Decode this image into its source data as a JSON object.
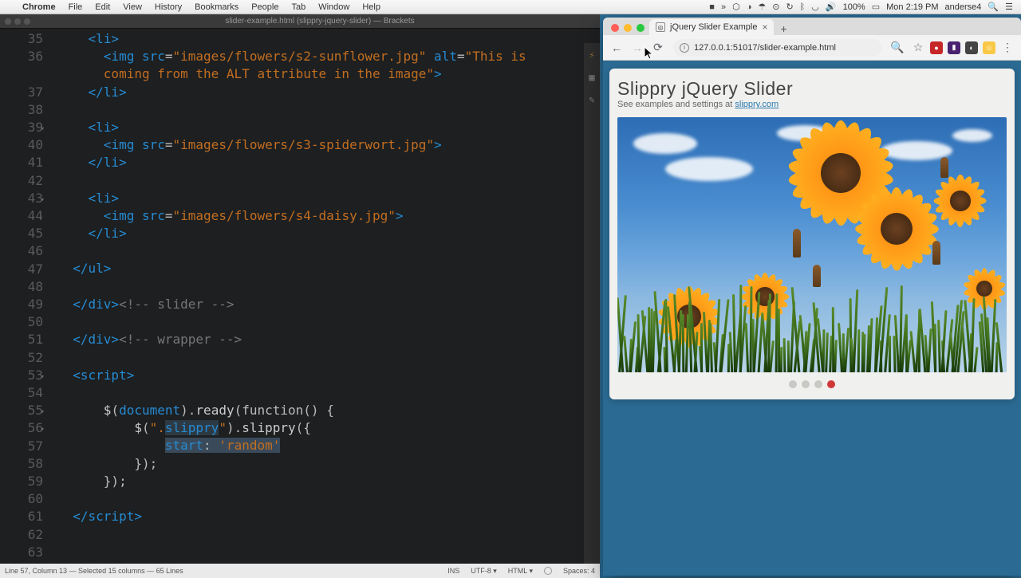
{
  "menubar": {
    "app": "Chrome",
    "items": [
      "File",
      "Edit",
      "View",
      "History",
      "Bookmarks",
      "People",
      "Tab",
      "Window",
      "Help"
    ],
    "time": "Mon 2:19 PM",
    "user": "anderse4",
    "battery": "100%"
  },
  "brackets": {
    "title": "slider-example.html (slippry-jquery-slider) — Brackets",
    "code": {
      "lines": [
        {
          "n": 35,
          "fold": false,
          "segs": [
            [
              "    ",
              "plain"
            ],
            [
              "<li>",
              "tag"
            ]
          ]
        },
        {
          "n": 36,
          "fold": false,
          "segs": [
            [
              "      ",
              "plain"
            ],
            [
              "<img ",
              "tag"
            ],
            [
              "src",
              "attr"
            ],
            [
              "=",
              "punct"
            ],
            [
              "\"images/flowers/s2-sunflower.jpg\"",
              "str"
            ],
            [
              " ",
              "plain"
            ],
            [
              "alt",
              "attr"
            ],
            [
              "=",
              "punct"
            ],
            [
              "\"This is",
              "str"
            ]
          ]
        },
        {
          "n": 0,
          "cont": true,
          "segs": [
            [
              "      ",
              "plain"
            ],
            [
              "coming from the ALT attribute in the image\"",
              "str"
            ],
            [
              ">",
              "tag"
            ]
          ]
        },
        {
          "n": 37,
          "fold": false,
          "segs": [
            [
              "    ",
              "plain"
            ],
            [
              "</li>",
              "tag"
            ]
          ]
        },
        {
          "n": 38,
          "fold": false,
          "segs": []
        },
        {
          "n": 39,
          "fold": true,
          "segs": [
            [
              "    ",
              "plain"
            ],
            [
              "<li>",
              "tag"
            ]
          ]
        },
        {
          "n": 40,
          "fold": false,
          "segs": [
            [
              "      ",
              "plain"
            ],
            [
              "<img ",
              "tag"
            ],
            [
              "src",
              "attr"
            ],
            [
              "=",
              "punct"
            ],
            [
              "\"images/flowers/s3-spiderwort.jpg\"",
              "str"
            ],
            [
              ">",
              "tag"
            ]
          ]
        },
        {
          "n": 41,
          "fold": false,
          "segs": [
            [
              "    ",
              "plain"
            ],
            [
              "</li>",
              "tag"
            ]
          ]
        },
        {
          "n": 42,
          "fold": false,
          "segs": []
        },
        {
          "n": 43,
          "fold": true,
          "segs": [
            [
              "    ",
              "plain"
            ],
            [
              "<li>",
              "tag"
            ]
          ]
        },
        {
          "n": 44,
          "fold": false,
          "segs": [
            [
              "      ",
              "plain"
            ],
            [
              "<img ",
              "tag"
            ],
            [
              "src",
              "attr"
            ],
            [
              "=",
              "punct"
            ],
            [
              "\"images/flowers/s4-daisy.jpg\"",
              "str"
            ],
            [
              ">",
              "tag"
            ]
          ]
        },
        {
          "n": 45,
          "fold": false,
          "segs": [
            [
              "    ",
              "plain"
            ],
            [
              "</li>",
              "tag"
            ]
          ]
        },
        {
          "n": 46,
          "fold": false,
          "segs": []
        },
        {
          "n": 47,
          "fold": false,
          "segs": [
            [
              "  ",
              "plain"
            ],
            [
              "</ul>",
              "tag"
            ]
          ]
        },
        {
          "n": 48,
          "fold": false,
          "segs": []
        },
        {
          "n": 49,
          "fold": false,
          "segs": [
            [
              "  ",
              "plain"
            ],
            [
              "</div>",
              "tag"
            ],
            [
              "<!-- slider -->",
              "comment"
            ]
          ]
        },
        {
          "n": 50,
          "fold": false,
          "segs": []
        },
        {
          "n": 51,
          "fold": false,
          "segs": [
            [
              "  ",
              "plain"
            ],
            [
              "</div>",
              "tag"
            ],
            [
              "<!-- wrapper -->",
              "comment"
            ]
          ]
        },
        {
          "n": 52,
          "fold": false,
          "segs": []
        },
        {
          "n": 53,
          "fold": true,
          "segs": [
            [
              "  ",
              "plain"
            ],
            [
              "<script>",
              "tag"
            ]
          ]
        },
        {
          "n": 54,
          "fold": false,
          "segs": []
        },
        {
          "n": 55,
          "fold": true,
          "segs": [
            [
              "      ",
              "plain"
            ],
            [
              "$",
              "js"
            ],
            [
              "(",
              "punct"
            ],
            [
              "document",
              "jsprop"
            ],
            [
              ")",
              "punct"
            ],
            [
              ".",
              "punct"
            ],
            [
              "ready",
              "js"
            ],
            [
              "(",
              "punct"
            ],
            [
              "function",
              "jsk"
            ],
            [
              "() {",
              "punct"
            ]
          ]
        },
        {
          "n": 56,
          "fold": true,
          "segs": [
            [
              "          ",
              "plain"
            ],
            [
              "$",
              "js"
            ],
            [
              "(",
              "punct"
            ],
            [
              "\".",
              "jsstr"
            ],
            [
              "slippry",
              "jsprop",
              "hl"
            ],
            [
              "\"",
              "jsstr"
            ],
            [
              ")",
              "punct"
            ],
            [
              ".",
              "punct"
            ],
            [
              "slippry",
              "js"
            ],
            [
              "({",
              "punct"
            ]
          ]
        },
        {
          "n": 57,
          "fold": false,
          "segs": [
            [
              "              ",
              "plain"
            ],
            [
              "start",
              "jsprop",
              "sel"
            ],
            [
              ": ",
              "punct",
              "sel"
            ],
            [
              "'random'",
              "jsstr",
              "sel"
            ]
          ]
        },
        {
          "n": 58,
          "fold": false,
          "segs": [
            [
              "          ",
              "plain"
            ],
            [
              "});",
              "punct"
            ]
          ]
        },
        {
          "n": 59,
          "fold": false,
          "segs": [
            [
              "      ",
              "plain"
            ],
            [
              "});",
              "punct"
            ]
          ]
        },
        {
          "n": 60,
          "fold": false,
          "segs": []
        },
        {
          "n": 61,
          "fold": false,
          "segs": [
            [
              "  ",
              "plain"
            ],
            [
              "</script>",
              "tag"
            ]
          ]
        },
        {
          "n": 62,
          "fold": false,
          "segs": []
        },
        {
          "n": 63,
          "fold": false,
          "segs": []
        }
      ]
    },
    "status": {
      "left": "Line 57, Column 13 — Selected 15 columns — 65 Lines",
      "ins": "INS",
      "enc": "UTF-8 ▾",
      "lang": "HTML ▾",
      "spaces": "Spaces: 4"
    }
  },
  "chrome": {
    "tab_title": "jQuery Slider Example",
    "url": "127.0.0.1:51017/slider-example.html"
  },
  "slider": {
    "title": "Slippry jQuery Slider",
    "sub_prefix": "See examples and settings at ",
    "sub_link": "slippry.com",
    "dots": 4,
    "active": 3
  }
}
